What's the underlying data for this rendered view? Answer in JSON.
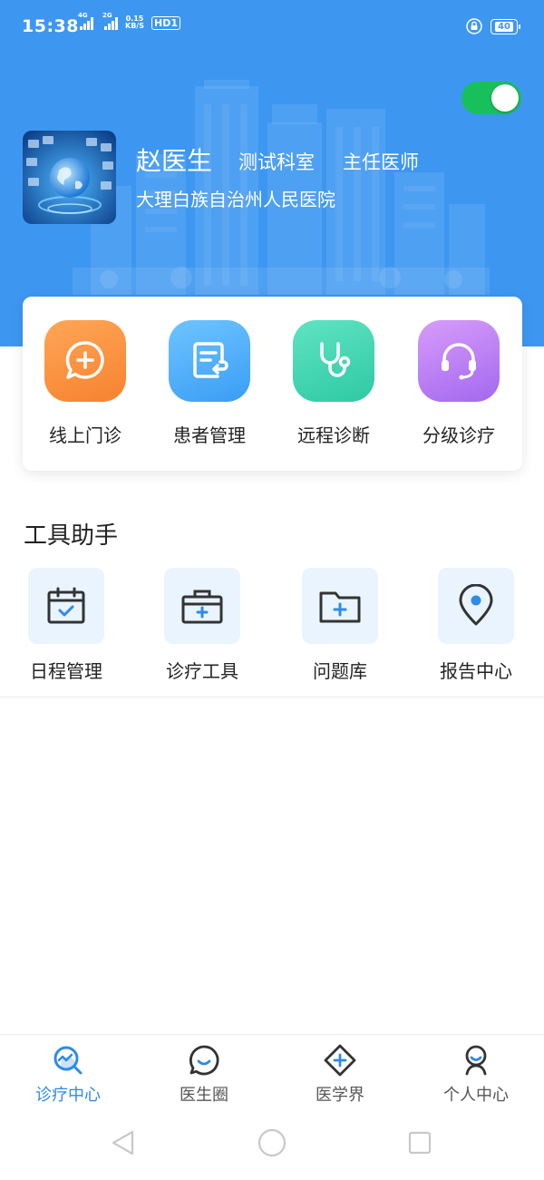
{
  "status_bar": {
    "time": "15:38",
    "signal_1_label": "4G",
    "signal_2_label": "2G",
    "speed_value": "0.15",
    "speed_unit": "KB/S",
    "hd_label": "HD1",
    "battery_level": "40",
    "icons": [
      "signal-icon",
      "lock-icon",
      "battery-icon"
    ]
  },
  "header": {
    "toggle_on": true,
    "doctor_name": "赵医生",
    "department": "测试科室",
    "title": "主任医师",
    "hospital": "大理白族自治州人民医院",
    "background_color": "#3d97f1"
  },
  "services": [
    {
      "label": "线上门诊",
      "icon": "chat-plus-icon",
      "color_from": "#ffa657",
      "color_to": "#f6822f"
    },
    {
      "label": "患者管理",
      "icon": "clipboard-return-icon",
      "color_from": "#6ec4ff",
      "color_to": "#3a9df5"
    },
    {
      "label": "远程诊断",
      "icon": "stethoscope-icon",
      "color_from": "#5fe3c2",
      "color_to": "#2fc9a4"
    },
    {
      "label": "分级诊疗",
      "icon": "headset-icon",
      "color_from": "#d79cf9",
      "color_to": "#a368ef"
    }
  ],
  "tools": {
    "section_title": "工具助手",
    "items": [
      {
        "label": "日程管理",
        "icon": "calendar-check-icon"
      },
      {
        "label": "诊疗工具",
        "icon": "medical-kit-icon"
      },
      {
        "label": "问题库",
        "icon": "folder-plus-icon"
      },
      {
        "label": "报告中心",
        "icon": "location-pin-icon"
      }
    ]
  },
  "tabbar": {
    "active_index": 0,
    "active_color": "#2f8ae8",
    "items": [
      {
        "label": "诊疗中心",
        "icon": "diagnosis-search-icon"
      },
      {
        "label": "医生圈",
        "icon": "smile-chat-icon"
      },
      {
        "label": "医学界",
        "icon": "diamond-plus-icon"
      },
      {
        "label": "个人中心",
        "icon": "person-icon"
      }
    ]
  },
  "system_nav": {
    "icons": [
      "back-icon",
      "home-icon",
      "recents-icon"
    ]
  }
}
